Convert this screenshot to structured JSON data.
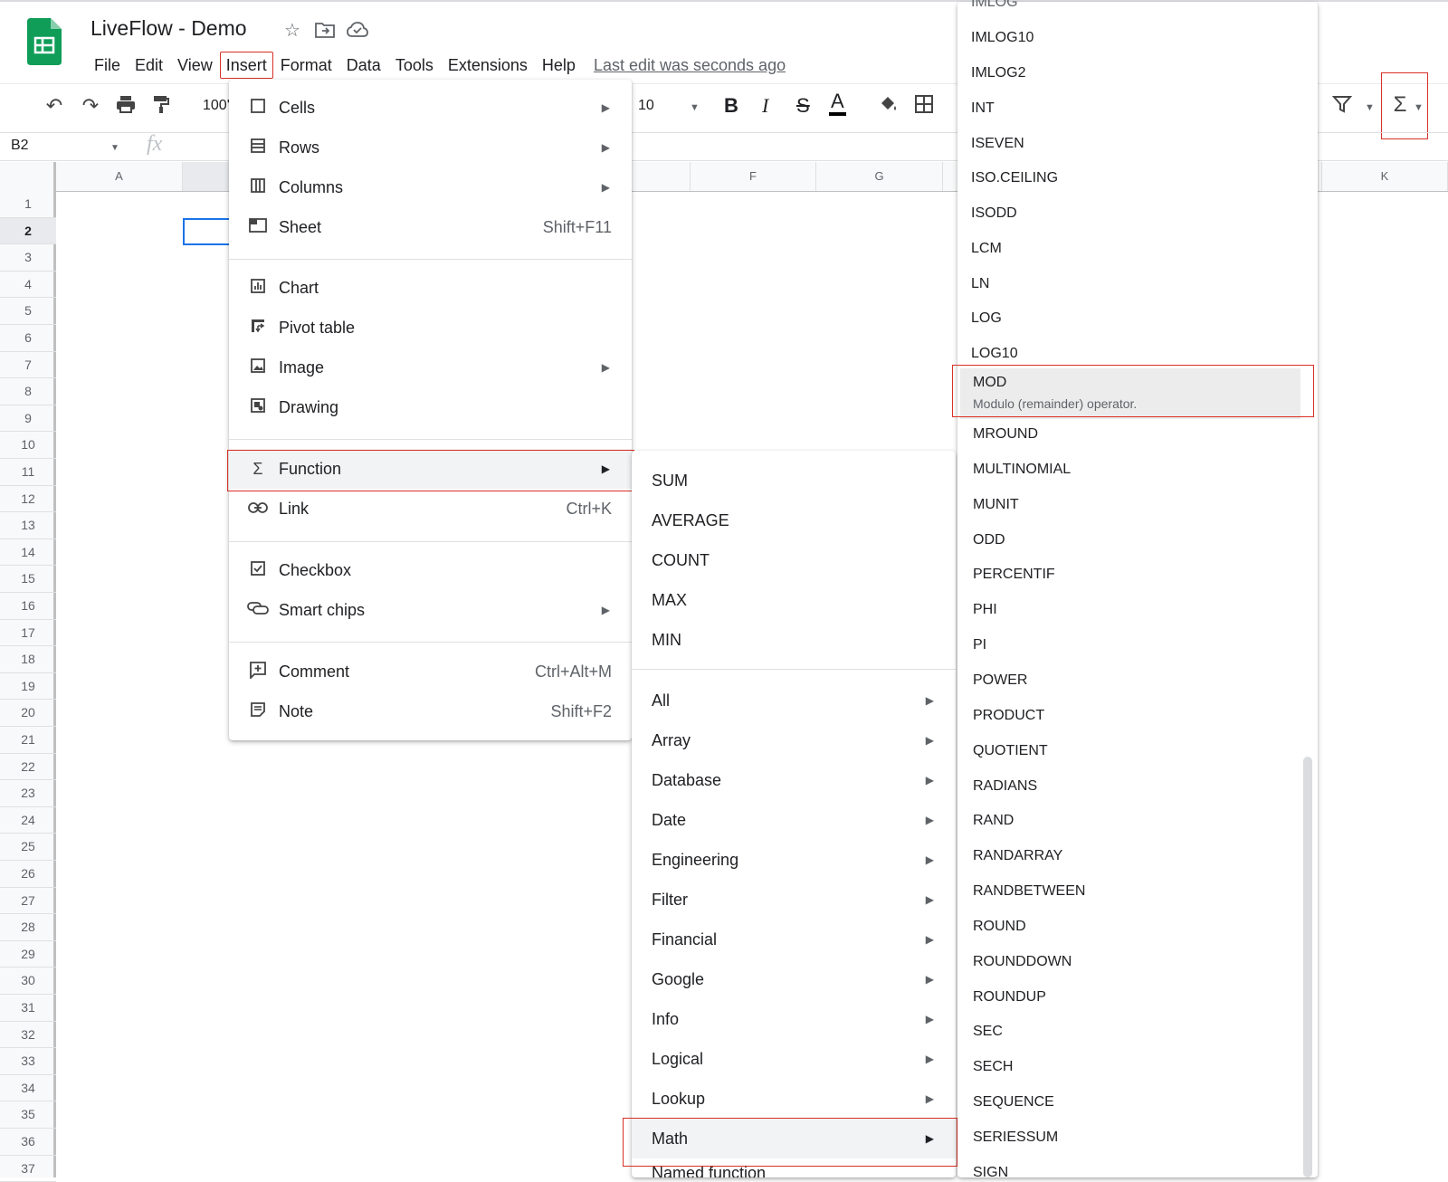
{
  "header": {
    "title": "LiveFlow - Demo",
    "icons": [
      "star-icon",
      "move-to-folder-icon",
      "cloud-status-icon"
    ],
    "last_edit": "Last edit was seconds ago"
  },
  "menubar": [
    "File",
    "Edit",
    "View",
    "Insert",
    "Format",
    "Data",
    "Tools",
    "Extensions",
    "Help"
  ],
  "toolbar": {
    "zoom": "100'",
    "font_size": "10",
    "bold": "B",
    "italic": "I",
    "strike": "S",
    "text_color": "A",
    "sigma": "Σ"
  },
  "formula_bar": {
    "cell_ref": "B2",
    "fx": "fx"
  },
  "columns": [
    "A",
    "",
    "F",
    "G",
    "K"
  ],
  "rows": [
    "1",
    "2",
    "3",
    "4",
    "5",
    "6",
    "7",
    "8",
    "9",
    "10",
    "11",
    "12",
    "13",
    "14",
    "15",
    "16",
    "17",
    "18",
    "19",
    "20",
    "21",
    "22",
    "23",
    "24",
    "25",
    "26",
    "27",
    "28",
    "29",
    "30",
    "31",
    "32",
    "33",
    "34",
    "35",
    "36",
    "37"
  ],
  "insert_menu": {
    "cells": "Cells",
    "rows": "Rows",
    "columns": "Columns",
    "sheet": "Sheet",
    "sheet_shortcut": "Shift+F11",
    "chart": "Chart",
    "pivot_table": "Pivot table",
    "image": "Image",
    "drawing": "Drawing",
    "function": "Function",
    "link": "Link",
    "link_shortcut": "Ctrl+K",
    "checkbox": "Checkbox",
    "smart_chips": "Smart chips",
    "comment": "Comment",
    "comment_shortcut": "Ctrl+Alt+M",
    "note": "Note",
    "note_shortcut": "Shift+F2"
  },
  "function_menu": {
    "quick": [
      "SUM",
      "AVERAGE",
      "COUNT",
      "MAX",
      "MIN"
    ],
    "categories": [
      "All",
      "Array",
      "Database",
      "Date",
      "Engineering",
      "Filter",
      "Financial",
      "Google",
      "Info",
      "Logical",
      "Lookup",
      "Math",
      "Named function"
    ]
  },
  "math_menu": {
    "items_top": [
      "IMLOG",
      "IMLOG10",
      "IMLOG2",
      "INT",
      "ISEVEN",
      "ISO.CEILING",
      "ISODD",
      "LCM",
      "LN",
      "LOG",
      "LOG10"
    ],
    "highlighted": "MOD",
    "highlighted_desc": "Modulo (remainder) operator.",
    "items_bottom": [
      "MROUND",
      "MULTINOMIAL",
      "MUNIT",
      "ODD",
      "PERCENTIF",
      "PHI",
      "PI",
      "POWER",
      "PRODUCT",
      "QUOTIENT",
      "RADIANS",
      "RAND",
      "RANDARRAY",
      "RANDBETWEEN",
      "ROUND",
      "ROUNDDOWN",
      "ROUNDUP",
      "SEC",
      "SECH",
      "SEQUENCE",
      "SERIESSUM",
      "SIGN"
    ]
  }
}
